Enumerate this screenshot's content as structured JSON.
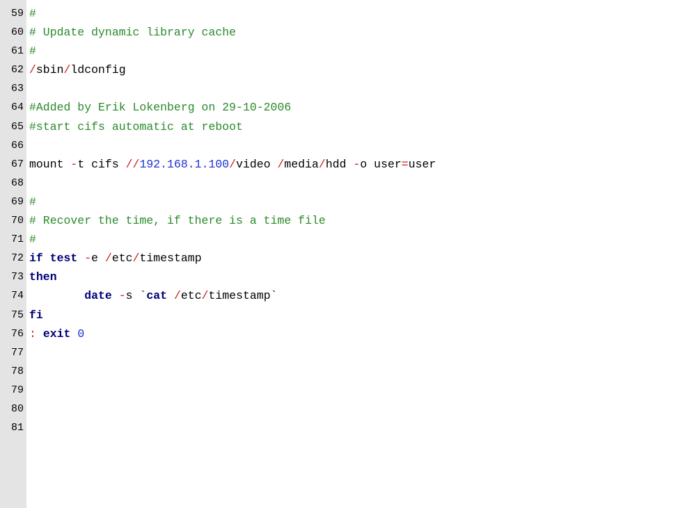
{
  "colors": {
    "gutter_bg": "#e4e4e4",
    "comment": "#2a8a2a",
    "operator": "#d11a1a",
    "ip_number": "#1c2fd6",
    "keyword": "#00007a",
    "text": "#000000"
  },
  "lines": [
    {
      "num": "59",
      "tokens": [
        {
          "t": "#",
          "k": "comment"
        }
      ]
    },
    {
      "num": "60",
      "tokens": [
        {
          "t": "# Update dynamic library cache",
          "k": "comment"
        }
      ]
    },
    {
      "num": "61",
      "tokens": [
        {
          "t": "#",
          "k": "comment"
        }
      ]
    },
    {
      "num": "62",
      "tokens": [
        {
          "t": "/",
          "k": "op"
        },
        {
          "t": "sbin",
          "k": "text"
        },
        {
          "t": "/",
          "k": "op"
        },
        {
          "t": "ldconfig",
          "k": "text"
        }
      ]
    },
    {
      "num": "63",
      "tokens": []
    },
    {
      "num": "64",
      "tokens": [
        {
          "t": "#Added by Erik Lokenberg on 29-10-2006",
          "k": "comment"
        }
      ]
    },
    {
      "num": "65",
      "tokens": [
        {
          "t": "#start cifs automatic at reboot",
          "k": "comment"
        }
      ]
    },
    {
      "num": "66",
      "tokens": []
    },
    {
      "num": "67",
      "tokens": [
        {
          "t": "mount ",
          "k": "text"
        },
        {
          "t": "-",
          "k": "op"
        },
        {
          "t": "t cifs ",
          "k": "text"
        },
        {
          "t": "//",
          "k": "op"
        },
        {
          "t": "192.168.1.100",
          "k": "ip"
        },
        {
          "t": "/",
          "k": "op"
        },
        {
          "t": "video ",
          "k": "text"
        },
        {
          "t": "/",
          "k": "op"
        },
        {
          "t": "media",
          "k": "text"
        },
        {
          "t": "/",
          "k": "op"
        },
        {
          "t": "hdd ",
          "k": "text"
        },
        {
          "t": "-",
          "k": "op"
        },
        {
          "t": "o user",
          "k": "text"
        },
        {
          "t": "=",
          "k": "op"
        },
        {
          "t": "user",
          "k": "text"
        }
      ]
    },
    {
      "num": "68",
      "tokens": []
    },
    {
      "num": "69",
      "tokens": [
        {
          "t": "#",
          "k": "comment"
        }
      ]
    },
    {
      "num": "70",
      "tokens": [
        {
          "t": "# Recover the time, if there is a time file",
          "k": "comment"
        }
      ]
    },
    {
      "num": "71",
      "tokens": [
        {
          "t": "#",
          "k": "comment"
        }
      ]
    },
    {
      "num": "72",
      "tokens": [
        {
          "t": "if",
          "k": "kw"
        },
        {
          "t": " ",
          "k": "text"
        },
        {
          "t": "test",
          "k": "kw"
        },
        {
          "t": " ",
          "k": "text"
        },
        {
          "t": "-",
          "k": "op"
        },
        {
          "t": "e ",
          "k": "text"
        },
        {
          "t": "/",
          "k": "op"
        },
        {
          "t": "etc",
          "k": "text"
        },
        {
          "t": "/",
          "k": "op"
        },
        {
          "t": "timestamp",
          "k": "text"
        }
      ]
    },
    {
      "num": "73",
      "tokens": [
        {
          "t": "then",
          "k": "kw"
        }
      ]
    },
    {
      "num": "74",
      "tokens": [
        {
          "t": "        ",
          "k": "text"
        },
        {
          "t": "date",
          "k": "kw"
        },
        {
          "t": " ",
          "k": "text"
        },
        {
          "t": "-",
          "k": "op"
        },
        {
          "t": "s `",
          "k": "text"
        },
        {
          "t": "cat",
          "k": "kw"
        },
        {
          "t": " ",
          "k": "text"
        },
        {
          "t": "/",
          "k": "op"
        },
        {
          "t": "etc",
          "k": "text"
        },
        {
          "t": "/",
          "k": "op"
        },
        {
          "t": "timestamp`",
          "k": "text"
        }
      ]
    },
    {
      "num": "75",
      "tokens": [
        {
          "t": "fi",
          "k": "kw"
        }
      ]
    },
    {
      "num": "76",
      "tokens": [
        {
          "t": ":",
          "k": "op"
        },
        {
          "t": " ",
          "k": "text"
        },
        {
          "t": "exit",
          "k": "kw"
        },
        {
          "t": " ",
          "k": "text"
        },
        {
          "t": "0",
          "k": "num"
        }
      ]
    },
    {
      "num": "77",
      "tokens": []
    },
    {
      "num": "78",
      "tokens": []
    },
    {
      "num": "79",
      "tokens": []
    },
    {
      "num": "80",
      "tokens": []
    },
    {
      "num": "81",
      "tokens": []
    }
  ]
}
